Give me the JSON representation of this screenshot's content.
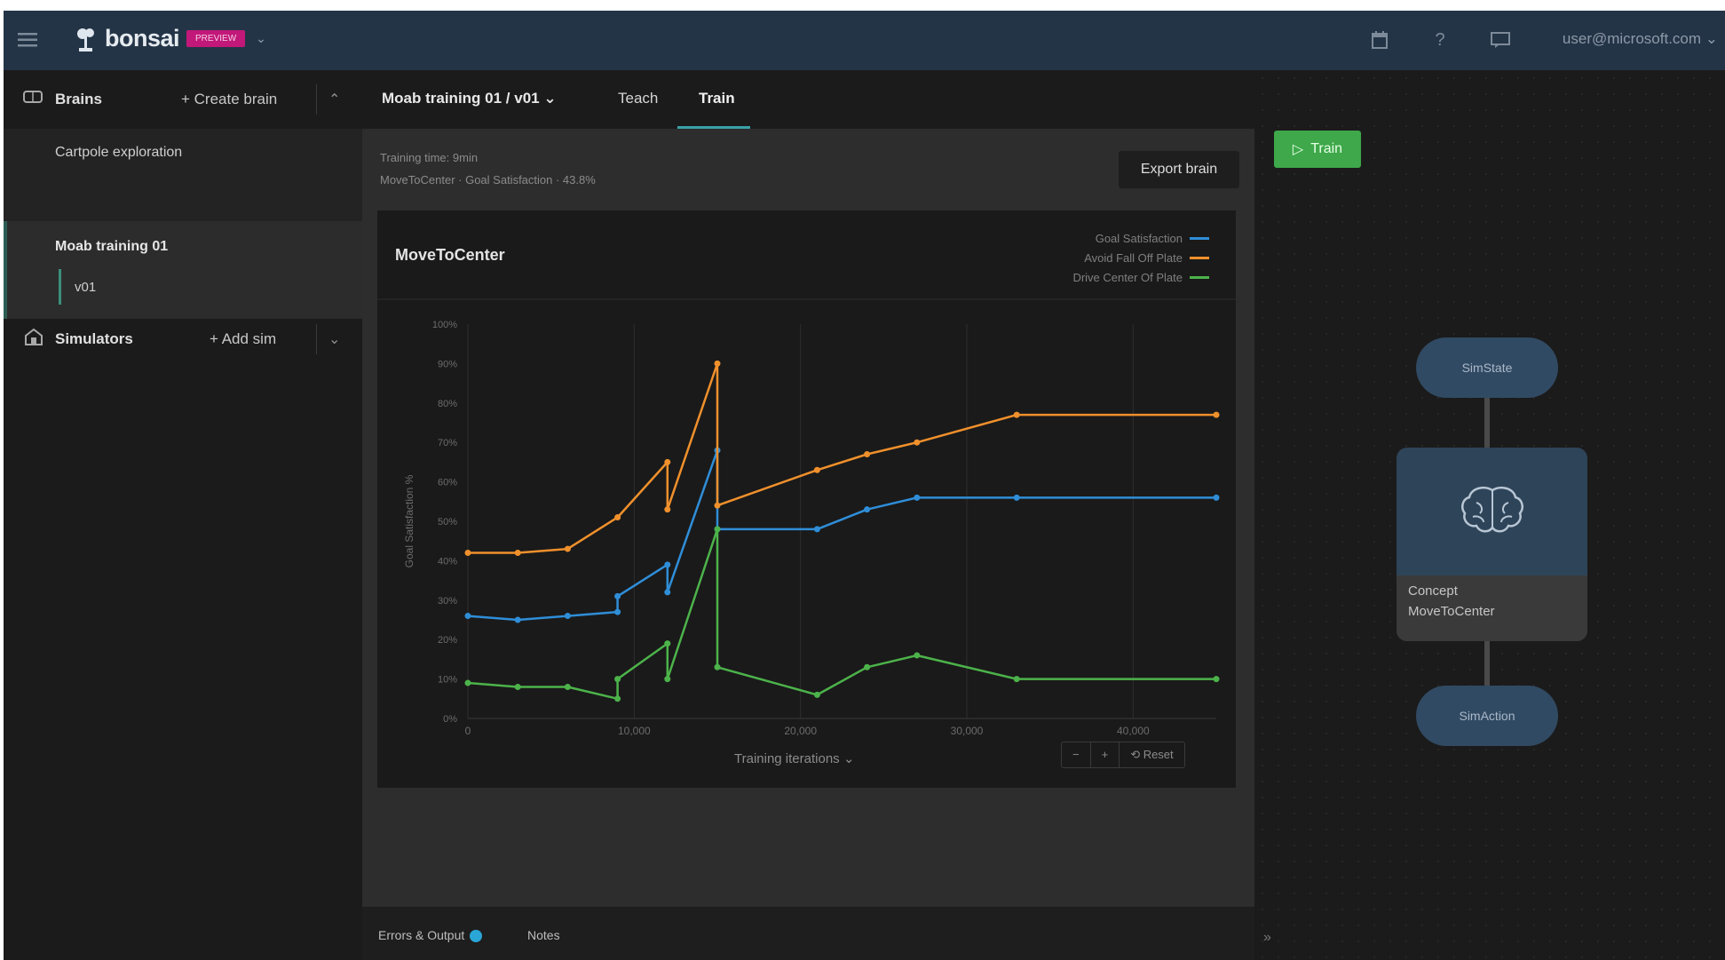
{
  "header": {
    "brand_name": "bonsai",
    "badge": "preview",
    "user": "user@microsoft.com ⌄"
  },
  "sidebar": {
    "brains_title": "Brains",
    "create_brain": "+ Create brain",
    "items": [
      "Cartpole exploration",
      "Moab training 01"
    ],
    "version": "v01",
    "simulators_title": "Simulators",
    "add_sim": "+ Add sim"
  },
  "main": {
    "brain_version": "Moab training 01 / v01 ⌄",
    "tabs": [
      "Teach",
      "Train"
    ],
    "active_tab": "Train",
    "training_status_line1": "Training time: 9min",
    "training_status_line2": "MoveToCenter · Goal Satisfaction · 43.8%",
    "export_label": "Export brain",
    "x_axis_selector": "Training iterations ⌄",
    "zoom_out": "−",
    "zoom_in": "+",
    "zoom_reset": "⟲ Reset",
    "bottom_tabs": [
      "Errors & Output",
      "Notes"
    ]
  },
  "right_panel": {
    "train_label": "Train",
    "node_top": "SimState",
    "concept_line1": "Concept",
    "concept_line2": "MoveToCenter",
    "node_bottom": "SimAction"
  },
  "icons": {
    "menu": "hamburger-icon",
    "calendar": "calendar-icon",
    "help": "help-icon",
    "feedback": "feedback-icon",
    "brains": "brain-icon",
    "simulators": "simulator-icon",
    "concept": "brain-icon",
    "play": "play-icon"
  },
  "colors": {
    "topbar": "#243447",
    "goal": "#2f8ed8",
    "avoid": "#f0902c",
    "drive": "#4cb34a",
    "train_button": "#3ea84a",
    "tab_underline": "#3aa0a8",
    "badge": "#c2187a"
  },
  "chart_data": {
    "type": "line",
    "title": "MoveToCenter",
    "xlabel": "Training iterations",
    "ylabel": "Goal Satisfaction %",
    "x_ticks": [
      "0",
      "10,000",
      "20,000",
      "30,000",
      "40,000"
    ],
    "y_ticks": [
      "0%",
      "10%",
      "20%",
      "30%",
      "40%",
      "50%",
      "60%",
      "70%",
      "80%",
      "90%",
      "100%"
    ],
    "xlim": [
      0,
      45000
    ],
    "ylim": [
      0,
      100
    ],
    "grid": true,
    "legend": "top-right",
    "series": [
      {
        "name": "Goal Satisfaction",
        "color": "#2f8ed8",
        "points": [
          [
            0,
            26
          ],
          [
            3000,
            25
          ],
          [
            6000,
            26
          ],
          [
            9000,
            27
          ],
          [
            9000,
            31
          ],
          [
            12000,
            39
          ],
          [
            12000,
            32
          ],
          [
            15000,
            68
          ],
          [
            15000,
            48
          ],
          [
            21000,
            48
          ],
          [
            24000,
            53
          ],
          [
            27000,
            56
          ],
          [
            33000,
            56
          ],
          [
            45000,
            56
          ]
        ]
      },
      {
        "name": "Avoid Fall Off Plate",
        "color": "#f0902c",
        "points": [
          [
            0,
            42
          ],
          [
            3000,
            42
          ],
          [
            6000,
            43
          ],
          [
            9000,
            51
          ],
          [
            12000,
            65
          ],
          [
            12000,
            53
          ],
          [
            15000,
            90
          ],
          [
            15000,
            54
          ],
          [
            21000,
            63
          ],
          [
            24000,
            67
          ],
          [
            27000,
            70
          ],
          [
            33000,
            77
          ],
          [
            45000,
            77
          ]
        ]
      },
      {
        "name": "Drive Center Of Plate",
        "color": "#4cb34a",
        "points": [
          [
            0,
            9
          ],
          [
            3000,
            8
          ],
          [
            6000,
            8
          ],
          [
            9000,
            5
          ],
          [
            9000,
            10
          ],
          [
            12000,
            19
          ],
          [
            12000,
            10
          ],
          [
            15000,
            48
          ],
          [
            15000,
            13
          ],
          [
            21000,
            6
          ],
          [
            24000,
            13
          ],
          [
            27000,
            16
          ],
          [
            33000,
            10
          ],
          [
            45000,
            10
          ]
        ]
      }
    ]
  }
}
